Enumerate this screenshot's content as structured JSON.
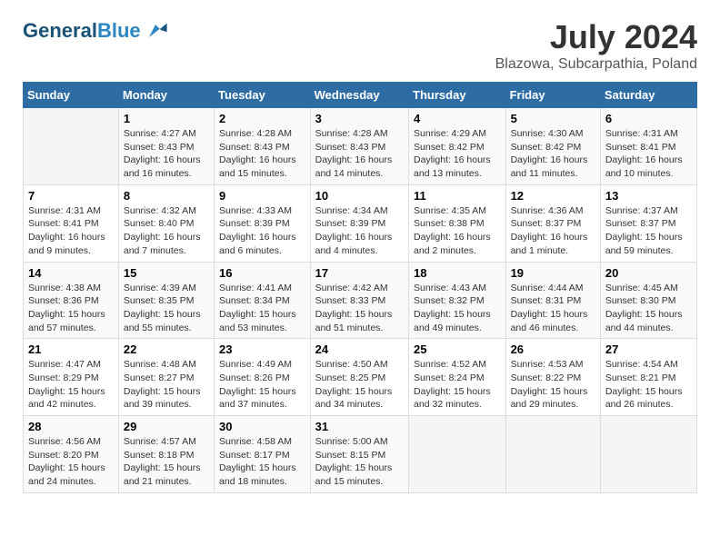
{
  "header": {
    "logo_line1": "General",
    "logo_line2": "Blue",
    "month_title": "July 2024",
    "location": "Blazowa, Subcarpathia, Poland"
  },
  "weekdays": [
    "Sunday",
    "Monday",
    "Tuesday",
    "Wednesday",
    "Thursday",
    "Friday",
    "Saturday"
  ],
  "weeks": [
    [
      {
        "day": "",
        "info": ""
      },
      {
        "day": "1",
        "info": "Sunrise: 4:27 AM\nSunset: 8:43 PM\nDaylight: 16 hours\nand 16 minutes."
      },
      {
        "day": "2",
        "info": "Sunrise: 4:28 AM\nSunset: 8:43 PM\nDaylight: 16 hours\nand 15 minutes."
      },
      {
        "day": "3",
        "info": "Sunrise: 4:28 AM\nSunset: 8:43 PM\nDaylight: 16 hours\nand 14 minutes."
      },
      {
        "day": "4",
        "info": "Sunrise: 4:29 AM\nSunset: 8:42 PM\nDaylight: 16 hours\nand 13 minutes."
      },
      {
        "day": "5",
        "info": "Sunrise: 4:30 AM\nSunset: 8:42 PM\nDaylight: 16 hours\nand 11 minutes."
      },
      {
        "day": "6",
        "info": "Sunrise: 4:31 AM\nSunset: 8:41 PM\nDaylight: 16 hours\nand 10 minutes."
      }
    ],
    [
      {
        "day": "7",
        "info": "Sunrise: 4:31 AM\nSunset: 8:41 PM\nDaylight: 16 hours\nand 9 minutes."
      },
      {
        "day": "8",
        "info": "Sunrise: 4:32 AM\nSunset: 8:40 PM\nDaylight: 16 hours\nand 7 minutes."
      },
      {
        "day": "9",
        "info": "Sunrise: 4:33 AM\nSunset: 8:39 PM\nDaylight: 16 hours\nand 6 minutes."
      },
      {
        "day": "10",
        "info": "Sunrise: 4:34 AM\nSunset: 8:39 PM\nDaylight: 16 hours\nand 4 minutes."
      },
      {
        "day": "11",
        "info": "Sunrise: 4:35 AM\nSunset: 8:38 PM\nDaylight: 16 hours\nand 2 minutes."
      },
      {
        "day": "12",
        "info": "Sunrise: 4:36 AM\nSunset: 8:37 PM\nDaylight: 16 hours\nand 1 minute."
      },
      {
        "day": "13",
        "info": "Sunrise: 4:37 AM\nSunset: 8:37 PM\nDaylight: 15 hours\nand 59 minutes."
      }
    ],
    [
      {
        "day": "14",
        "info": "Sunrise: 4:38 AM\nSunset: 8:36 PM\nDaylight: 15 hours\nand 57 minutes."
      },
      {
        "day": "15",
        "info": "Sunrise: 4:39 AM\nSunset: 8:35 PM\nDaylight: 15 hours\nand 55 minutes."
      },
      {
        "day": "16",
        "info": "Sunrise: 4:41 AM\nSunset: 8:34 PM\nDaylight: 15 hours\nand 53 minutes."
      },
      {
        "day": "17",
        "info": "Sunrise: 4:42 AM\nSunset: 8:33 PM\nDaylight: 15 hours\nand 51 minutes."
      },
      {
        "day": "18",
        "info": "Sunrise: 4:43 AM\nSunset: 8:32 PM\nDaylight: 15 hours\nand 49 minutes."
      },
      {
        "day": "19",
        "info": "Sunrise: 4:44 AM\nSunset: 8:31 PM\nDaylight: 15 hours\nand 46 minutes."
      },
      {
        "day": "20",
        "info": "Sunrise: 4:45 AM\nSunset: 8:30 PM\nDaylight: 15 hours\nand 44 minutes."
      }
    ],
    [
      {
        "day": "21",
        "info": "Sunrise: 4:47 AM\nSunset: 8:29 PM\nDaylight: 15 hours\nand 42 minutes."
      },
      {
        "day": "22",
        "info": "Sunrise: 4:48 AM\nSunset: 8:27 PM\nDaylight: 15 hours\nand 39 minutes."
      },
      {
        "day": "23",
        "info": "Sunrise: 4:49 AM\nSunset: 8:26 PM\nDaylight: 15 hours\nand 37 minutes."
      },
      {
        "day": "24",
        "info": "Sunrise: 4:50 AM\nSunset: 8:25 PM\nDaylight: 15 hours\nand 34 minutes."
      },
      {
        "day": "25",
        "info": "Sunrise: 4:52 AM\nSunset: 8:24 PM\nDaylight: 15 hours\nand 32 minutes."
      },
      {
        "day": "26",
        "info": "Sunrise: 4:53 AM\nSunset: 8:22 PM\nDaylight: 15 hours\nand 29 minutes."
      },
      {
        "day": "27",
        "info": "Sunrise: 4:54 AM\nSunset: 8:21 PM\nDaylight: 15 hours\nand 26 minutes."
      }
    ],
    [
      {
        "day": "28",
        "info": "Sunrise: 4:56 AM\nSunset: 8:20 PM\nDaylight: 15 hours\nand 24 minutes."
      },
      {
        "day": "29",
        "info": "Sunrise: 4:57 AM\nSunset: 8:18 PM\nDaylight: 15 hours\nand 21 minutes."
      },
      {
        "day": "30",
        "info": "Sunrise: 4:58 AM\nSunset: 8:17 PM\nDaylight: 15 hours\nand 18 minutes."
      },
      {
        "day": "31",
        "info": "Sunrise: 5:00 AM\nSunset: 8:15 PM\nDaylight: 15 hours\nand 15 minutes."
      },
      {
        "day": "",
        "info": ""
      },
      {
        "day": "",
        "info": ""
      },
      {
        "day": "",
        "info": ""
      }
    ]
  ]
}
